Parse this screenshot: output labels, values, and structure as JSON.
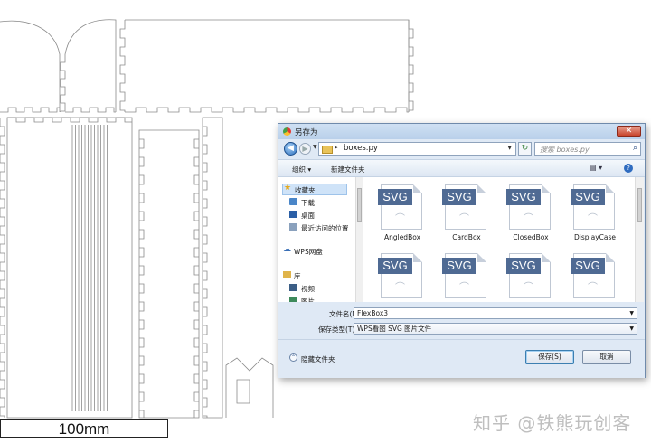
{
  "scale_label": "100mm",
  "watermark": "知乎 @铁熊玩创客",
  "dialog": {
    "title": "另存为",
    "close_glyph": "✕",
    "nav": {
      "back_glyph": "◀",
      "forward_glyph": "▶",
      "path_separator": "▸",
      "path": "boxes.py",
      "refresh_glyph": "↻",
      "search_placeholder": "搜索 boxes.py",
      "search_glyph": "⌕"
    },
    "toolbar": {
      "organize": "组织 ▾",
      "new_folder": "新建文件夹",
      "view_glyph": "▤ ▾",
      "help_glyph": "?"
    },
    "sidebar": {
      "favorites": "收藏夹",
      "downloads": "下载",
      "desktop": "桌面",
      "recent": "最近访问的位置",
      "wps_drive": "WPS网盘",
      "library": "库",
      "videos": "视频",
      "pictures": "图片"
    },
    "files": [
      {
        "badge": "SVG",
        "name": "AngledBox"
      },
      {
        "badge": "SVG",
        "name": "CardBox"
      },
      {
        "badge": "SVG",
        "name": "ClosedBox"
      },
      {
        "badge": "SVG",
        "name": "DisplayCase"
      },
      {
        "badge": "SVG",
        "name": ""
      },
      {
        "badge": "SVG",
        "name": ""
      },
      {
        "badge": "SVG",
        "name": ""
      },
      {
        "badge": "SVG",
        "name": ""
      }
    ],
    "filename_label": "文件名(N):",
    "filename_value": "FlexBox3",
    "filetype_label": "保存类型(T):",
    "filetype_value": "WPS看图 SVG 图片文件",
    "hide_folders": "隐藏文件夹",
    "save_button": "保存(S)",
    "cancel_button": "取消"
  }
}
